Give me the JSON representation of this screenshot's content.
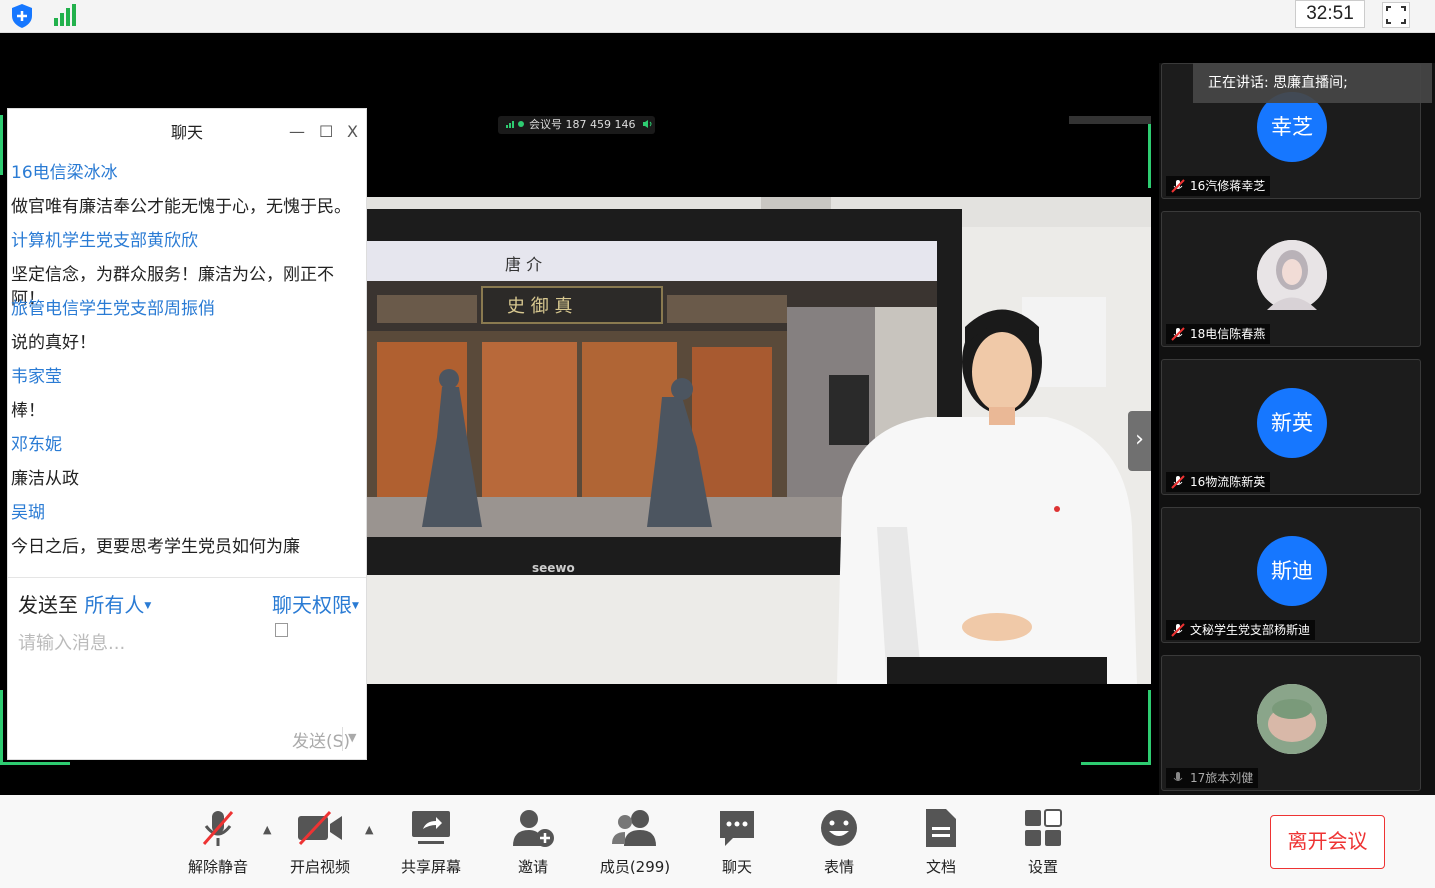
{
  "topbar": {
    "timer": "32:51"
  },
  "meeting": {
    "id_label": "会议号 187 459 146"
  },
  "chat": {
    "title": "聊天",
    "controls": {
      "minimize": "—",
      "maximize": "☐",
      "close": "X"
    },
    "messages": [
      {
        "name": "16电信梁冰冰",
        "text": "做官唯有廉洁奉公才能无愧于心，无愧于民。"
      },
      {
        "name": "计算机学生党支部黄欣欣",
        "text": "坚定信念，为群众服务！廉洁为公，刚正不阿！"
      },
      {
        "name": "旅管电信学生党支部周振俏",
        "text": "说的真好！"
      },
      {
        "name": "韦家莹",
        "text": "棒！"
      },
      {
        "name": "邓东妮",
        "text": "廉洁从政"
      },
      {
        "name": "吴瑚",
        "text": "今日之后，更要思考学生党员如何为廉"
      }
    ],
    "send_to_label": "发送至",
    "send_to_value": "所有人",
    "permission_label": "聊天权限",
    "input_placeholder": "请输入消息...",
    "send_button": "发送(S)"
  },
  "speaking": {
    "text": "正在讲话: 思廉直播间;"
  },
  "video": {
    "screen_title": "唐  介",
    "plaque": "史 御 真",
    "tv_brand": "seewo"
  },
  "participants": [
    {
      "avatar_text": "幸芝",
      "name": "16汽修蒋幸芝",
      "photo": false
    },
    {
      "avatar_text": "",
      "name": "18电信陈春燕",
      "photo": true
    },
    {
      "avatar_text": "新英",
      "name": "16物流陈新英",
      "photo": false
    },
    {
      "avatar_text": "斯迪",
      "name": "文秘学生党支部杨斯迪",
      "photo": false
    },
    {
      "avatar_text": "",
      "name": "17旅本刘健",
      "photo": true
    }
  ],
  "toolbar": {
    "unmute": "解除静音",
    "start_video": "开启视频",
    "share_screen": "共享屏幕",
    "invite": "邀请",
    "members": "成员(299)",
    "chat": "聊天",
    "emoji": "表情",
    "docs": "文档",
    "settings": "设置",
    "leave": "离开会议"
  },
  "colors": {
    "accent": "#1677ff",
    "link": "#2a7bd4",
    "leave": "#ee3333",
    "active_border": "#2ecc71"
  }
}
